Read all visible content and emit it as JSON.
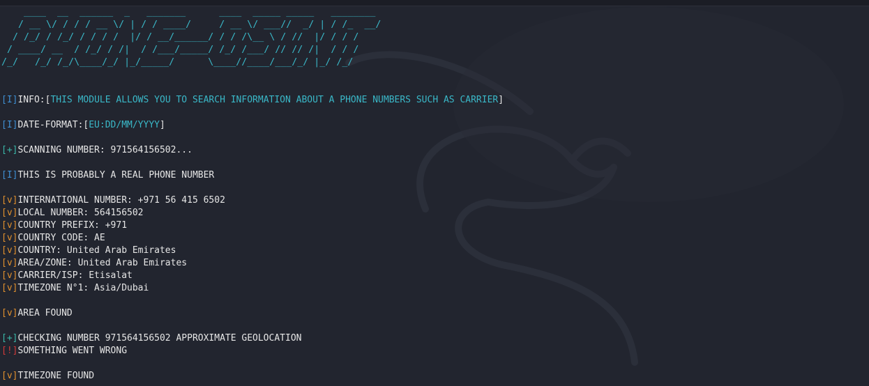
{
  "banner": {
    "lines": [
      "    ____  __  ______  _   _______      ____  _____ _____   ________",
      "   / __ \\/ / / / __ \\/ | / / ____/     / __ \\/ ___//  _/ | / /_  __/",
      "  / /_/ / /_/ / / / /  |/ / __/______/ / / /\\__ \\ / //  |/ / / /",
      " / ____/ __  / /_/ / /|  / /___/_____/ /_/ /___/ // // /|  / / /",
      "/_/   /_/ /_/\\____/_/ |_/_____/      \\____//____/___/_/ |_/ /_/"
    ]
  },
  "output": {
    "info_tag": "[I]",
    "info_label": "INFO:[",
    "info_text": "THIS MODULE ALLOWS YOU TO SEARCH INFORMATION ABOUT A PHONE NUMBERS SUCH AS CARRIER",
    "info_close": "]",
    "date_tag": "[I]",
    "date_label": "DATE-FORMAT:[",
    "date_text": "EU:DD/MM/YYYY",
    "date_close": "]",
    "scan_tag": "[+]",
    "scan_text": "SCANNING NUMBER: 971564156502...",
    "real_tag": "[I]",
    "real_text": "THIS IS PROBABLY A REAL PHONE NUMBER",
    "details": [
      {
        "tag": "[v]",
        "text": "INTERNATIONAL NUMBER: +971 56 415 6502"
      },
      {
        "tag": "[v]",
        "text": "LOCAL NUMBER: 564156502"
      },
      {
        "tag": "[v]",
        "text": "COUNTRY PREFIX: +971"
      },
      {
        "tag": "[v]",
        "text": "COUNTRY CODE: AE"
      },
      {
        "tag": "[v]",
        "text": "COUNTRY: United Arab Emirates"
      },
      {
        "tag": "[v]",
        "text": "AREA/ZONE: United Arab Emirates"
      },
      {
        "tag": "[v]",
        "text": "CARRIER/ISP: Etisalat"
      },
      {
        "tag": "[v]",
        "text": "TIMEZONE N°1: Asia/Dubai"
      }
    ],
    "area_tag": "[v]",
    "area_text": "AREA FOUND",
    "geo_tag": "[+]",
    "geo_text": "CHECKING NUMBER 971564156502 APPROXIMATE GEOLOCATION",
    "err_tag": "[!]",
    "err_text": "SOMETHING WENT WRONG",
    "tz_tag": "[v]",
    "tz_text": "TIMEZONE FOUND"
  },
  "colors": {
    "background": "#22252f",
    "banner": "#3ab8c8",
    "info_tag": "#3f8fd2",
    "plus_tag": "#3ab8a8",
    "found_tag": "#e0902e",
    "error_tag": "#d23a3a",
    "text": "#e6e6e6"
  }
}
